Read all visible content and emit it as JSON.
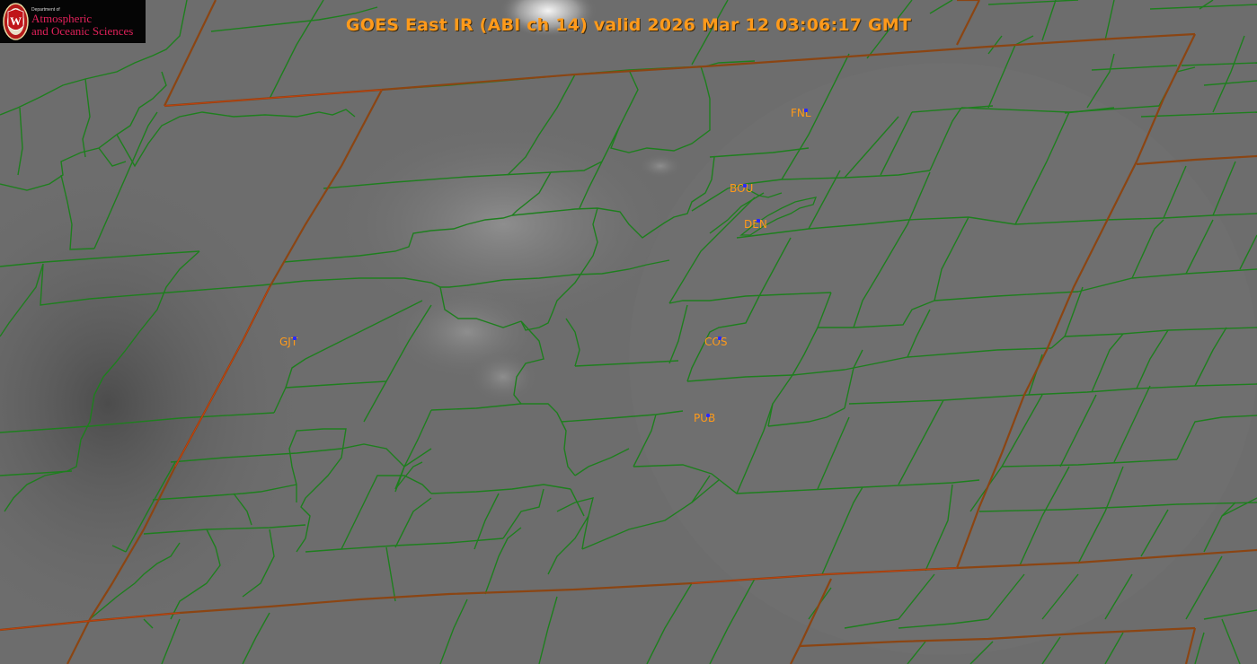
{
  "title": "GOES East IR (ABI ch 14) valid 2026 Mar 12 03:06:17 GMT",
  "logo": {
    "department": "Department of",
    "line1": "Atmospheric",
    "line2": "and Oceanic Sciences",
    "seal_letter": "W"
  },
  "stations": [
    {
      "id": "FNL"
    },
    {
      "id": "BOU"
    },
    {
      "id": "DEN"
    },
    {
      "id": "GJT"
    },
    {
      "id": "COS"
    },
    {
      "id": "PUB"
    }
  ],
  "colors": {
    "county_lines": "#1e7f1e",
    "state_lines": "#8b4513",
    "label": "#ff9a1a",
    "station_dot": "#2a2aff"
  }
}
